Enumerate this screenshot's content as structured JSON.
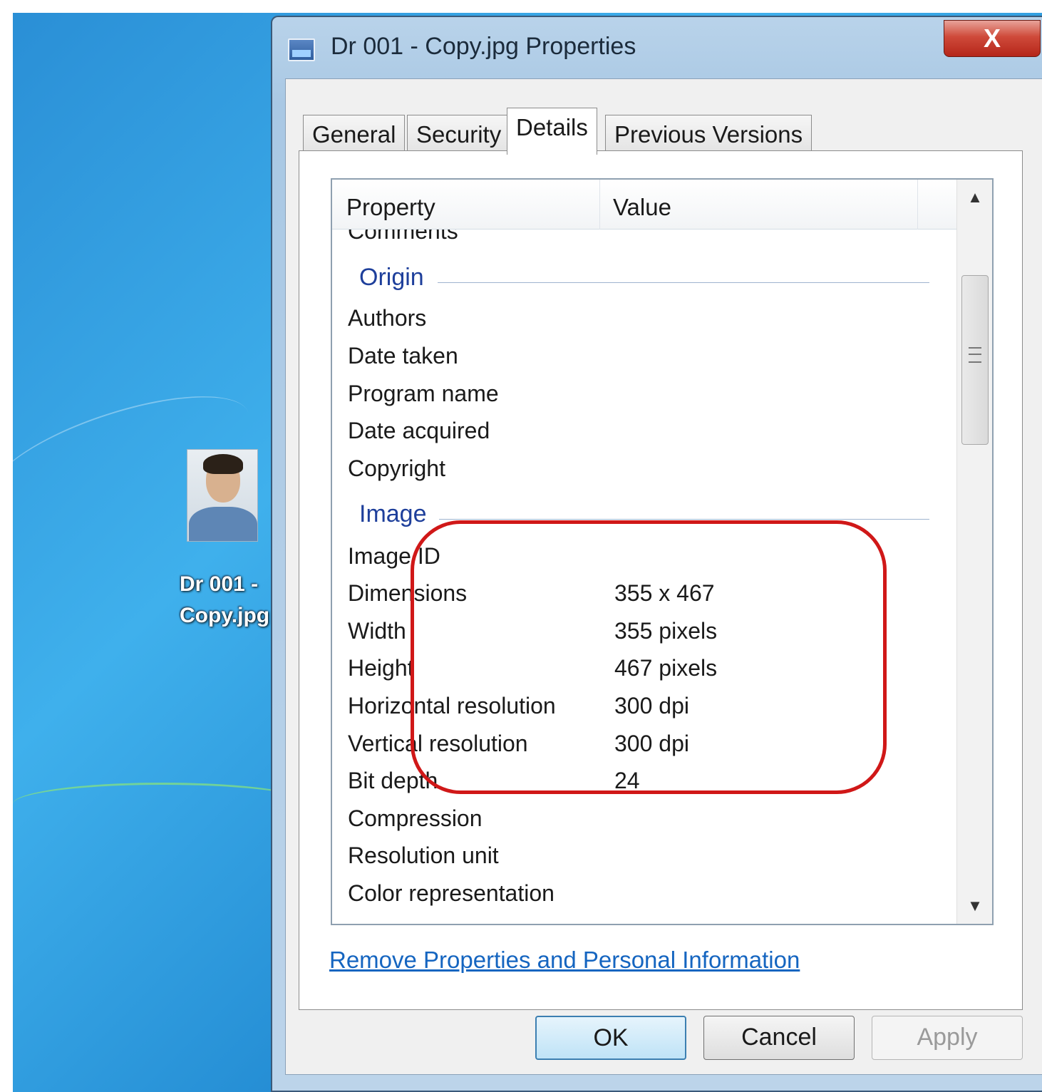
{
  "desktop": {
    "icon_label": "Dr 001 -\nCopy.jpg"
  },
  "window": {
    "title": "Dr 001 - Copy.jpg Properties",
    "close_glyph": "X",
    "tabs": [
      {
        "label": "General",
        "active": false
      },
      {
        "label": "Security",
        "active": false
      },
      {
        "label": "Details",
        "active": true
      },
      {
        "label": "Previous Versions",
        "active": false
      }
    ],
    "details": {
      "column_headers": {
        "property": "Property",
        "value": "Value"
      },
      "partially_visible_row": "Comments",
      "groups": [
        {
          "title": "Origin",
          "rows": [
            {
              "property": "Authors",
              "value": ""
            },
            {
              "property": "Date taken",
              "value": ""
            },
            {
              "property": "Program name",
              "value": ""
            },
            {
              "property": "Date acquired",
              "value": ""
            },
            {
              "property": "Copyright",
              "value": ""
            }
          ]
        },
        {
          "title": "Image",
          "rows": [
            {
              "property": "Image ID",
              "value": ""
            },
            {
              "property": "Dimensions",
              "value": "355 x 467"
            },
            {
              "property": "Width",
              "value": "355 pixels"
            },
            {
              "property": "Height",
              "value": "467 pixels"
            },
            {
              "property": "Horizontal resolution",
              "value": "300 dpi"
            },
            {
              "property": "Vertical resolution",
              "value": "300 dpi"
            },
            {
              "property": "Bit depth",
              "value": "24"
            },
            {
              "property": "Compression",
              "value": ""
            },
            {
              "property": "Resolution unit",
              "value": ""
            },
            {
              "property": "Color representation",
              "value": ""
            }
          ]
        }
      ],
      "scrollbar": {
        "up_glyph": "▲",
        "down_glyph": "▼"
      }
    },
    "remove_link": "Remove Properties and Personal Information",
    "buttons": {
      "ok": "OK",
      "cancel": "Cancel",
      "apply": "Apply"
    }
  },
  "annotation": {
    "highlight_color": "#d01818"
  }
}
